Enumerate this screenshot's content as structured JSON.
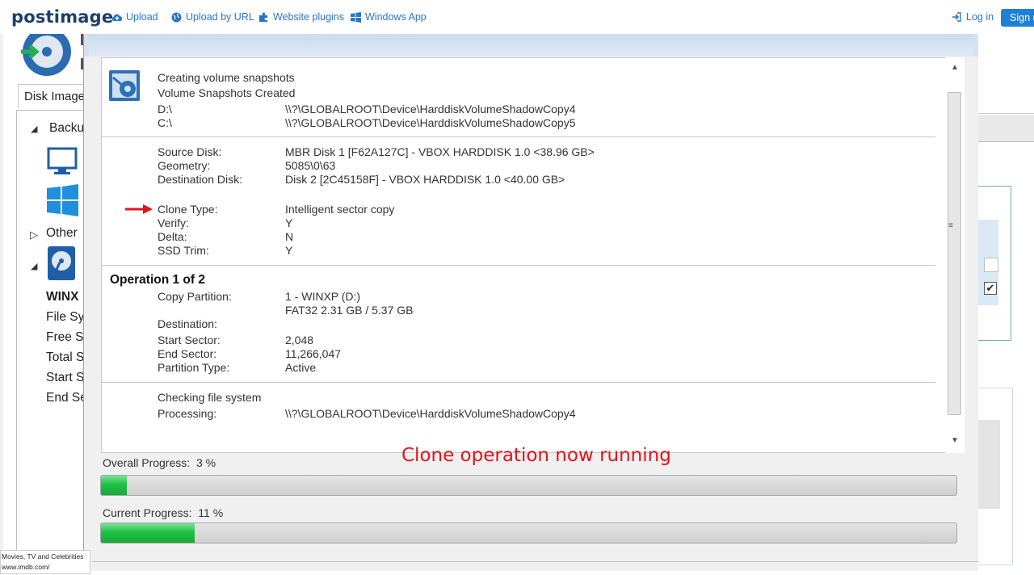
{
  "navbar": {
    "logo": "postimage",
    "links": [
      "Upload",
      "Upload by URL",
      "Website plugins",
      "Windows App"
    ],
    "login": "Log in",
    "signup": "Sign u"
  },
  "background_app": {
    "tab": "Disk Image",
    "tree": {
      "backup": "Backu",
      "other": "Other",
      "disk_name": "WINX",
      "props": [
        "File Sy",
        "Free Sp",
        "Total S",
        "Start S",
        "End Se"
      ]
    }
  },
  "log": {
    "snapshots": {
      "title": "Creating volume snapshots",
      "subtitle": "Volume Snapshots Created",
      "rows": [
        {
          "label": "D:\\",
          "value": "\\\\?\\GLOBALROOT\\Device\\HarddiskVolumeShadowCopy4"
        },
        {
          "label": "C:\\",
          "value": "\\\\?\\GLOBALROOT\\Device\\HarddiskVolumeShadowCopy5"
        }
      ]
    },
    "disks": [
      {
        "label": "Source Disk:",
        "value": "MBR Disk 1 [F62A127C] - VBOX HARDDISK 1.0  <38.96 GB>"
      },
      {
        "label": "Geometry:",
        "value": "5085\\0\\63"
      },
      {
        "label": "Destination Disk:",
        "value": " Disk 2 [2C45158F] - VBOX HARDDISK 1.0  <40.00 GB>"
      }
    ],
    "options": [
      {
        "label": "Clone Type:",
        "value": "Intelligent sector copy"
      },
      {
        "label": "Verify:",
        "value": "Y"
      },
      {
        "label": "Delta:",
        "value": "N"
      },
      {
        "label": "SSD Trim:",
        "value": "Y"
      }
    ],
    "operation": {
      "heading": "Operation 1 of 2",
      "copy_label": "Copy Partition:",
      "copy_value1": "1 - WINXP (D:)",
      "copy_value2": "FAT32 2.31 GB / 5.37 GB",
      "dest_label": "Destination:",
      "rows": [
        {
          "label": "Start Sector:",
          "value": "2,048"
        },
        {
          "label": "End Sector:",
          "value": "11,266,047"
        },
        {
          "label": "Partition Type:",
          "value": "Active"
        }
      ]
    },
    "check": {
      "title": "Checking file system",
      "label": "Processing:",
      "value": "\\\\?\\GLOBALROOT\\Device\\HarddiskVolumeShadowCopy4"
    }
  },
  "progress": {
    "annotation": "Clone operation now running",
    "overall_label": "Overall Progress:",
    "overall_text": "3 %",
    "overall_value": 0.03,
    "current_label": "Current Progress:",
    "current_text": "11 %",
    "current_value": 0.11,
    "color": "#1fc144"
  },
  "tooltip": {
    "line1": "Movies, TV and Celebrities",
    "line2": "www.imdb.com/"
  }
}
